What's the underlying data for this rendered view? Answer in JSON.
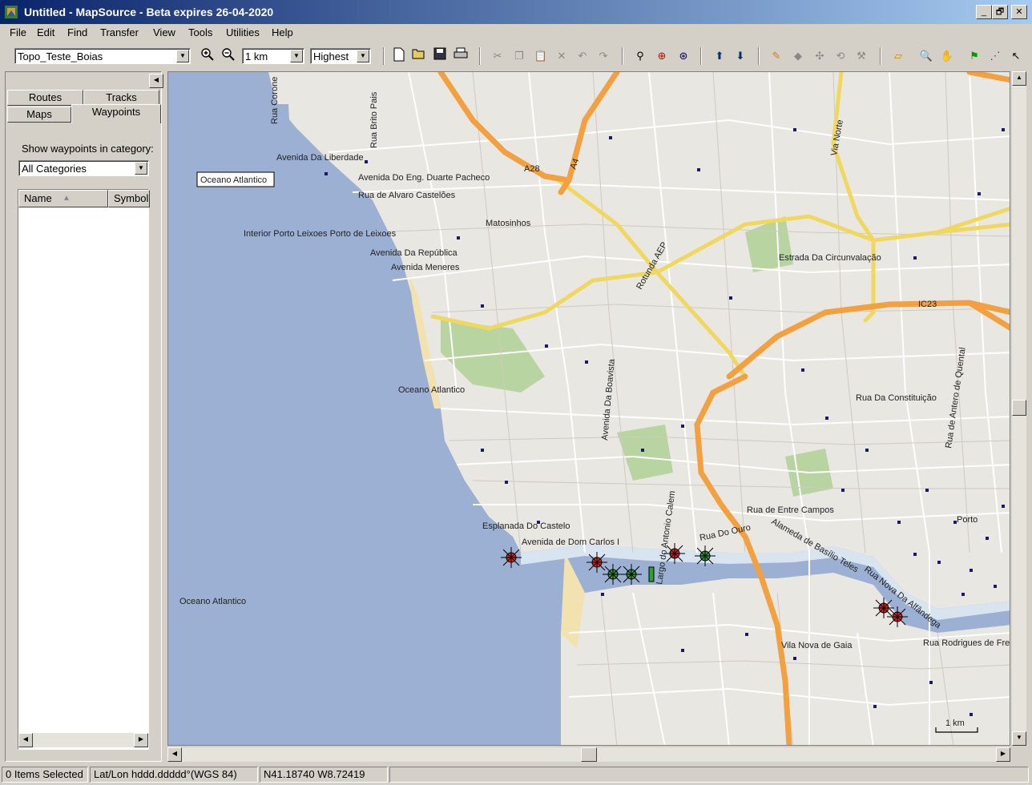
{
  "window": {
    "title": "Untitled - MapSource - Beta expires 26-04-2020",
    "min": "_",
    "restore": "🗗",
    "close": "✕"
  },
  "menu": [
    "File",
    "Edit",
    "Find",
    "Transfer",
    "View",
    "Tools",
    "Utilities",
    "Help"
  ],
  "toolbar": {
    "map_product": "Topo_Teste_Boias",
    "zoom_scale": "1 km",
    "detail": "Highest",
    "icons": [
      "zoom-in-icon",
      "zoom-out-icon",
      "new-icon",
      "open-icon",
      "save-icon",
      "print-icon",
      "cut-icon",
      "copy-icon",
      "paste-icon",
      "delete-icon",
      "undo-icon",
      "redo-icon",
      "find-icon",
      "find-nearby-icon",
      "find-places-icon",
      "receive-from-device-icon",
      "send-to-device-icon",
      "map-tool-icon",
      "eraser-icon",
      "route-tool-icon",
      "track-tool-icon",
      "distance-tool-icon",
      "area-select-icon",
      "zoom-tool-icon",
      "pan-tool-icon",
      "waypoint-tool-icon",
      "route-draw-icon",
      "select-tool-icon"
    ]
  },
  "left_panel": {
    "tabs": [
      "Routes",
      "Tracks",
      "Maps",
      "Waypoints"
    ],
    "active_tab": "Waypoints",
    "category_label": "Show waypoints in category:",
    "category_value": "All Categories",
    "columns": [
      "Name",
      "Symbol"
    ]
  },
  "map": {
    "labels": {
      "ocean1": "Oceano Atlantico",
      "ocean2": "Oceano Atlantico",
      "ocean3": "Oceano Atlantico",
      "av_liberdade": "Avenida Da Liberdade",
      "av_duarte": "Avenida Do Eng. Duarte Pacheco",
      "rua_alvaro": "Rua de Alvaro Castelões",
      "matosinhos": "Matosinhos",
      "porto_leixoes": "Interior Porto Leixoes Porto de Leixoes",
      "av_republica": "Avenida Da República",
      "av_meneres": "Avenida Meneres",
      "estrada_circ": "Estrada Da Circunvalação",
      "rua_constituicao": "Rua Da Constituição",
      "av_boavista": "Avenida Da Boavista",
      "rua_entre_campos": "Rua de Entre Campos",
      "esplanada": "Esplanada Do Castelo",
      "av_dom_carlos": "Avenida de Dom Carlos I",
      "rua_do_ouro": "Rua Do Ouro",
      "alameda": "Alameda de Basílio Teles",
      "rua_nova": "Rua Nova Da Alfândega",
      "vila_nova": "Vila Nova de Gaia",
      "rua_rodrigues": "Rua Rodrigues de Freitas",
      "porto": "Porto",
      "a28": "A28",
      "a4": "A4",
      "ic23": "IC23",
      "rotunda": "Rotunda AEP",
      "via_norte": "Via Norte",
      "rua_corone": "Rua Corone",
      "rua_brito": "Rua Brito Pais",
      "rua_antero": "Rua de Antero de Quental",
      "largo": "Largo do Antonio Calem",
      "scale": "1 km"
    }
  },
  "status": {
    "selected": "0 Items Selected",
    "format": "Lat/Lon hddd.ddddd°(WGS 84)",
    "coords": "N41.18740 W8.72419"
  }
}
